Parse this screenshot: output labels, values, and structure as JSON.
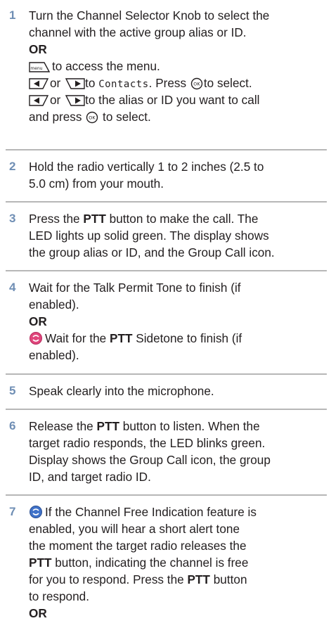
{
  "steps": [
    {
      "number": "1",
      "lines": {
        "a": "Turn the Channel Selector Knob to select the",
        "b": "channel with the active group alias or ID.",
        "or": "OR",
        "c": "to access the menu.",
        "d_or": "or",
        "d_to": "to",
        "d_menu": "Contacts",
        "d_press": ". Press",
        "d_select": "to select.",
        "e_or": "or",
        "e_text": "to the alias or ID you want to call",
        "f": "and press",
        "f_select": "to select."
      }
    },
    {
      "number": "2",
      "lines": {
        "a": "Hold the radio vertically 1 to 2 inches (2.5 to",
        "b": "5.0 cm) from your mouth."
      }
    },
    {
      "number": "3",
      "lines": {
        "a1": "Press the ",
        "a_bold": "PTT",
        "a2": " button to make the call. The",
        "b": "LED lights up solid green. The display shows",
        "c": "the group alias or ID, and the Group Call icon."
      }
    },
    {
      "number": "4",
      "lines": {
        "a": "Wait for the Talk Permit Tone to finish (if",
        "b": "enabled).",
        "or": "OR",
        "c1": "Wait for the ",
        "c_bold": "PTT",
        "c2": " Sidetone to finish (if",
        "d": "enabled)."
      }
    },
    {
      "number": "5",
      "lines": {
        "a": "Speak clearly into the microphone."
      }
    },
    {
      "number": "6",
      "lines": {
        "a1": "Release the ",
        "a_bold": "PTT",
        "a2": " button to listen. When the",
        "b": "target radio responds, the LED blinks green.",
        "c": "Display shows the Group Call icon, the group",
        "d": "ID, and target radio ID."
      }
    },
    {
      "number": "7",
      "lines": {
        "a": "If the Channel Free Indication feature is",
        "b": "enabled, you will hear a short alert tone",
        "c": "the moment the target radio releases the",
        "d_bold": "PTT",
        "d2": " button, indicating the channel is free",
        "e1": "for you to respond. Press the ",
        "e_bold": "PTT",
        "e2": " button",
        "f": "to respond.",
        "or": "OR"
      }
    }
  ],
  "icons": {
    "menu_key_label": "menu",
    "ok_key_label": "OK",
    "accent": "#6f8eb4",
    "feature_icon_pink": "#e0467c",
    "feature_icon_blue": "#3f72c9"
  }
}
